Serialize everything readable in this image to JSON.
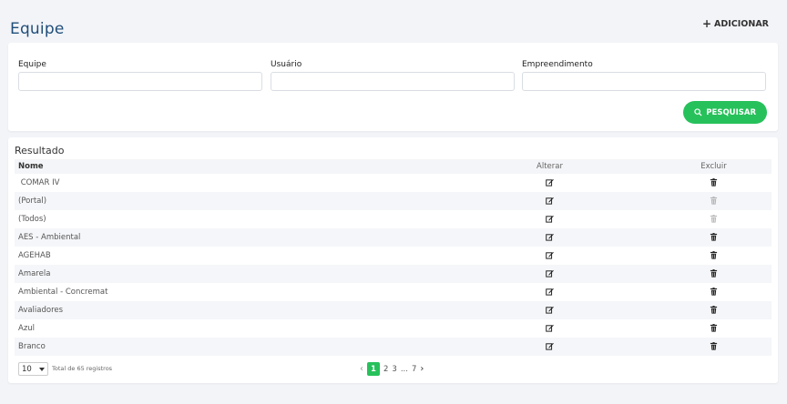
{
  "header": {
    "title": "Equipe",
    "add_label": "ADICIONAR"
  },
  "filters": {
    "fields": [
      {
        "label": "Equipe",
        "value": ""
      },
      {
        "label": "Usuário",
        "value": ""
      },
      {
        "label": "Empreendimento",
        "value": ""
      }
    ],
    "search_label": "PESQUISAR"
  },
  "results": {
    "title": "Resultado",
    "columns": {
      "name": "Nome",
      "edit": "Alterar",
      "delete": "Excluir"
    },
    "rows": [
      {
        "name": " COMAR IV",
        "delete_enabled": true
      },
      {
        "name": "(Portal)",
        "delete_enabled": false
      },
      {
        "name": "(Todos)",
        "delete_enabled": false
      },
      {
        "name": "AES - Ambiental",
        "delete_enabled": true
      },
      {
        "name": "AGEHAB",
        "delete_enabled": true
      },
      {
        "name": "Amarela",
        "delete_enabled": true
      },
      {
        "name": "Ambiental - Concremat",
        "delete_enabled": true
      },
      {
        "name": "Avaliadores",
        "delete_enabled": true
      },
      {
        "name": "Azul",
        "delete_enabled": true
      },
      {
        "name": "Branco",
        "delete_enabled": true
      }
    ]
  },
  "pagination": {
    "page_size": "10",
    "total_text": "Total de 65 registros",
    "pages": [
      "1",
      "2",
      "3",
      "...",
      "7"
    ],
    "current_page": "1"
  },
  "colors": {
    "accent": "#27c15b",
    "title": "#1f4e79"
  },
  "icons": {
    "add": "plus-icon",
    "search": "search-icon",
    "edit": "edit-icon",
    "delete": "trash-icon"
  }
}
